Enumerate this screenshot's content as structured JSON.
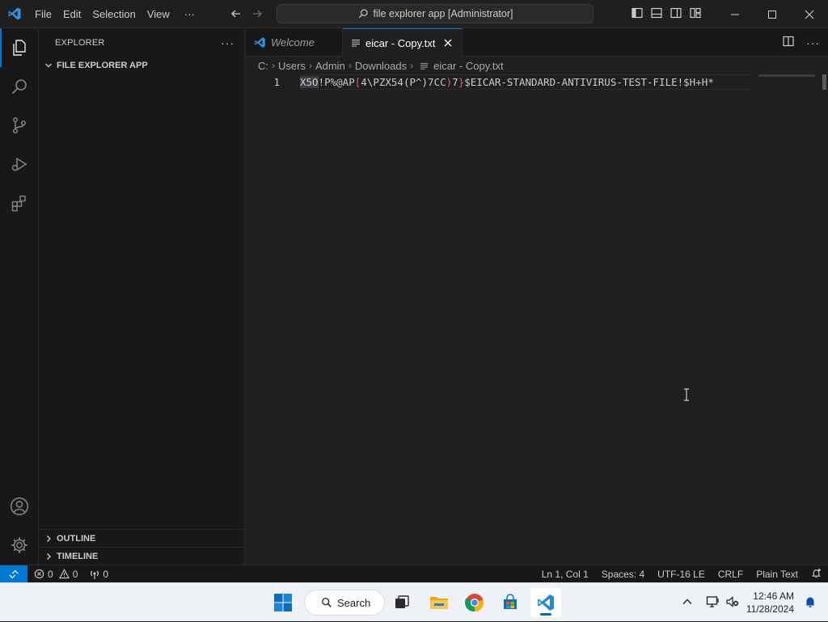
{
  "titlebar": {
    "menu": [
      "File",
      "Edit",
      "Selection",
      "View"
    ],
    "more": "···",
    "command_center": "file explorer app [Administrator]"
  },
  "sidebar": {
    "title": "EXPLORER",
    "folder": "FILE EXPLORER APP",
    "outline": "OUTLINE",
    "timeline": "TIMELINE"
  },
  "tabs": [
    {
      "label": "Welcome",
      "active": false
    },
    {
      "label": "eicar - Copy.txt",
      "active": true
    }
  ],
  "breadcrumb": [
    "C:",
    "Users",
    "Admin",
    "Downloads",
    "eicar - Copy.txt"
  ],
  "editor": {
    "line_number": "1",
    "code_sel": "X5O",
    "code_a": "!P%@AP",
    "code_b": "[",
    "code_c": "4\\PZX54(P^)7CC",
    "code_d": ")",
    "code_e": "7",
    "code_f": "}",
    "code_g": "$EICAR-STANDARD-ANTIVIRUS-TEST-FILE!$H+H*"
  },
  "statusbar": {
    "errors": "0",
    "warnings": "0",
    "ports": "0",
    "position": "Ln 1, Col 1",
    "spaces": "Spaces: 4",
    "encoding": "UTF-16 LE",
    "eol": "CRLF",
    "language": "Plain Text"
  },
  "taskbar": {
    "search_label": "Search",
    "time": "12:46 AM",
    "date": "11/28/2024"
  },
  "colors": {
    "accent": "#0078d4",
    "editor_bg": "#1f1f1f",
    "sidebar_bg": "#181818",
    "bracket_highlight": "#d46565"
  }
}
